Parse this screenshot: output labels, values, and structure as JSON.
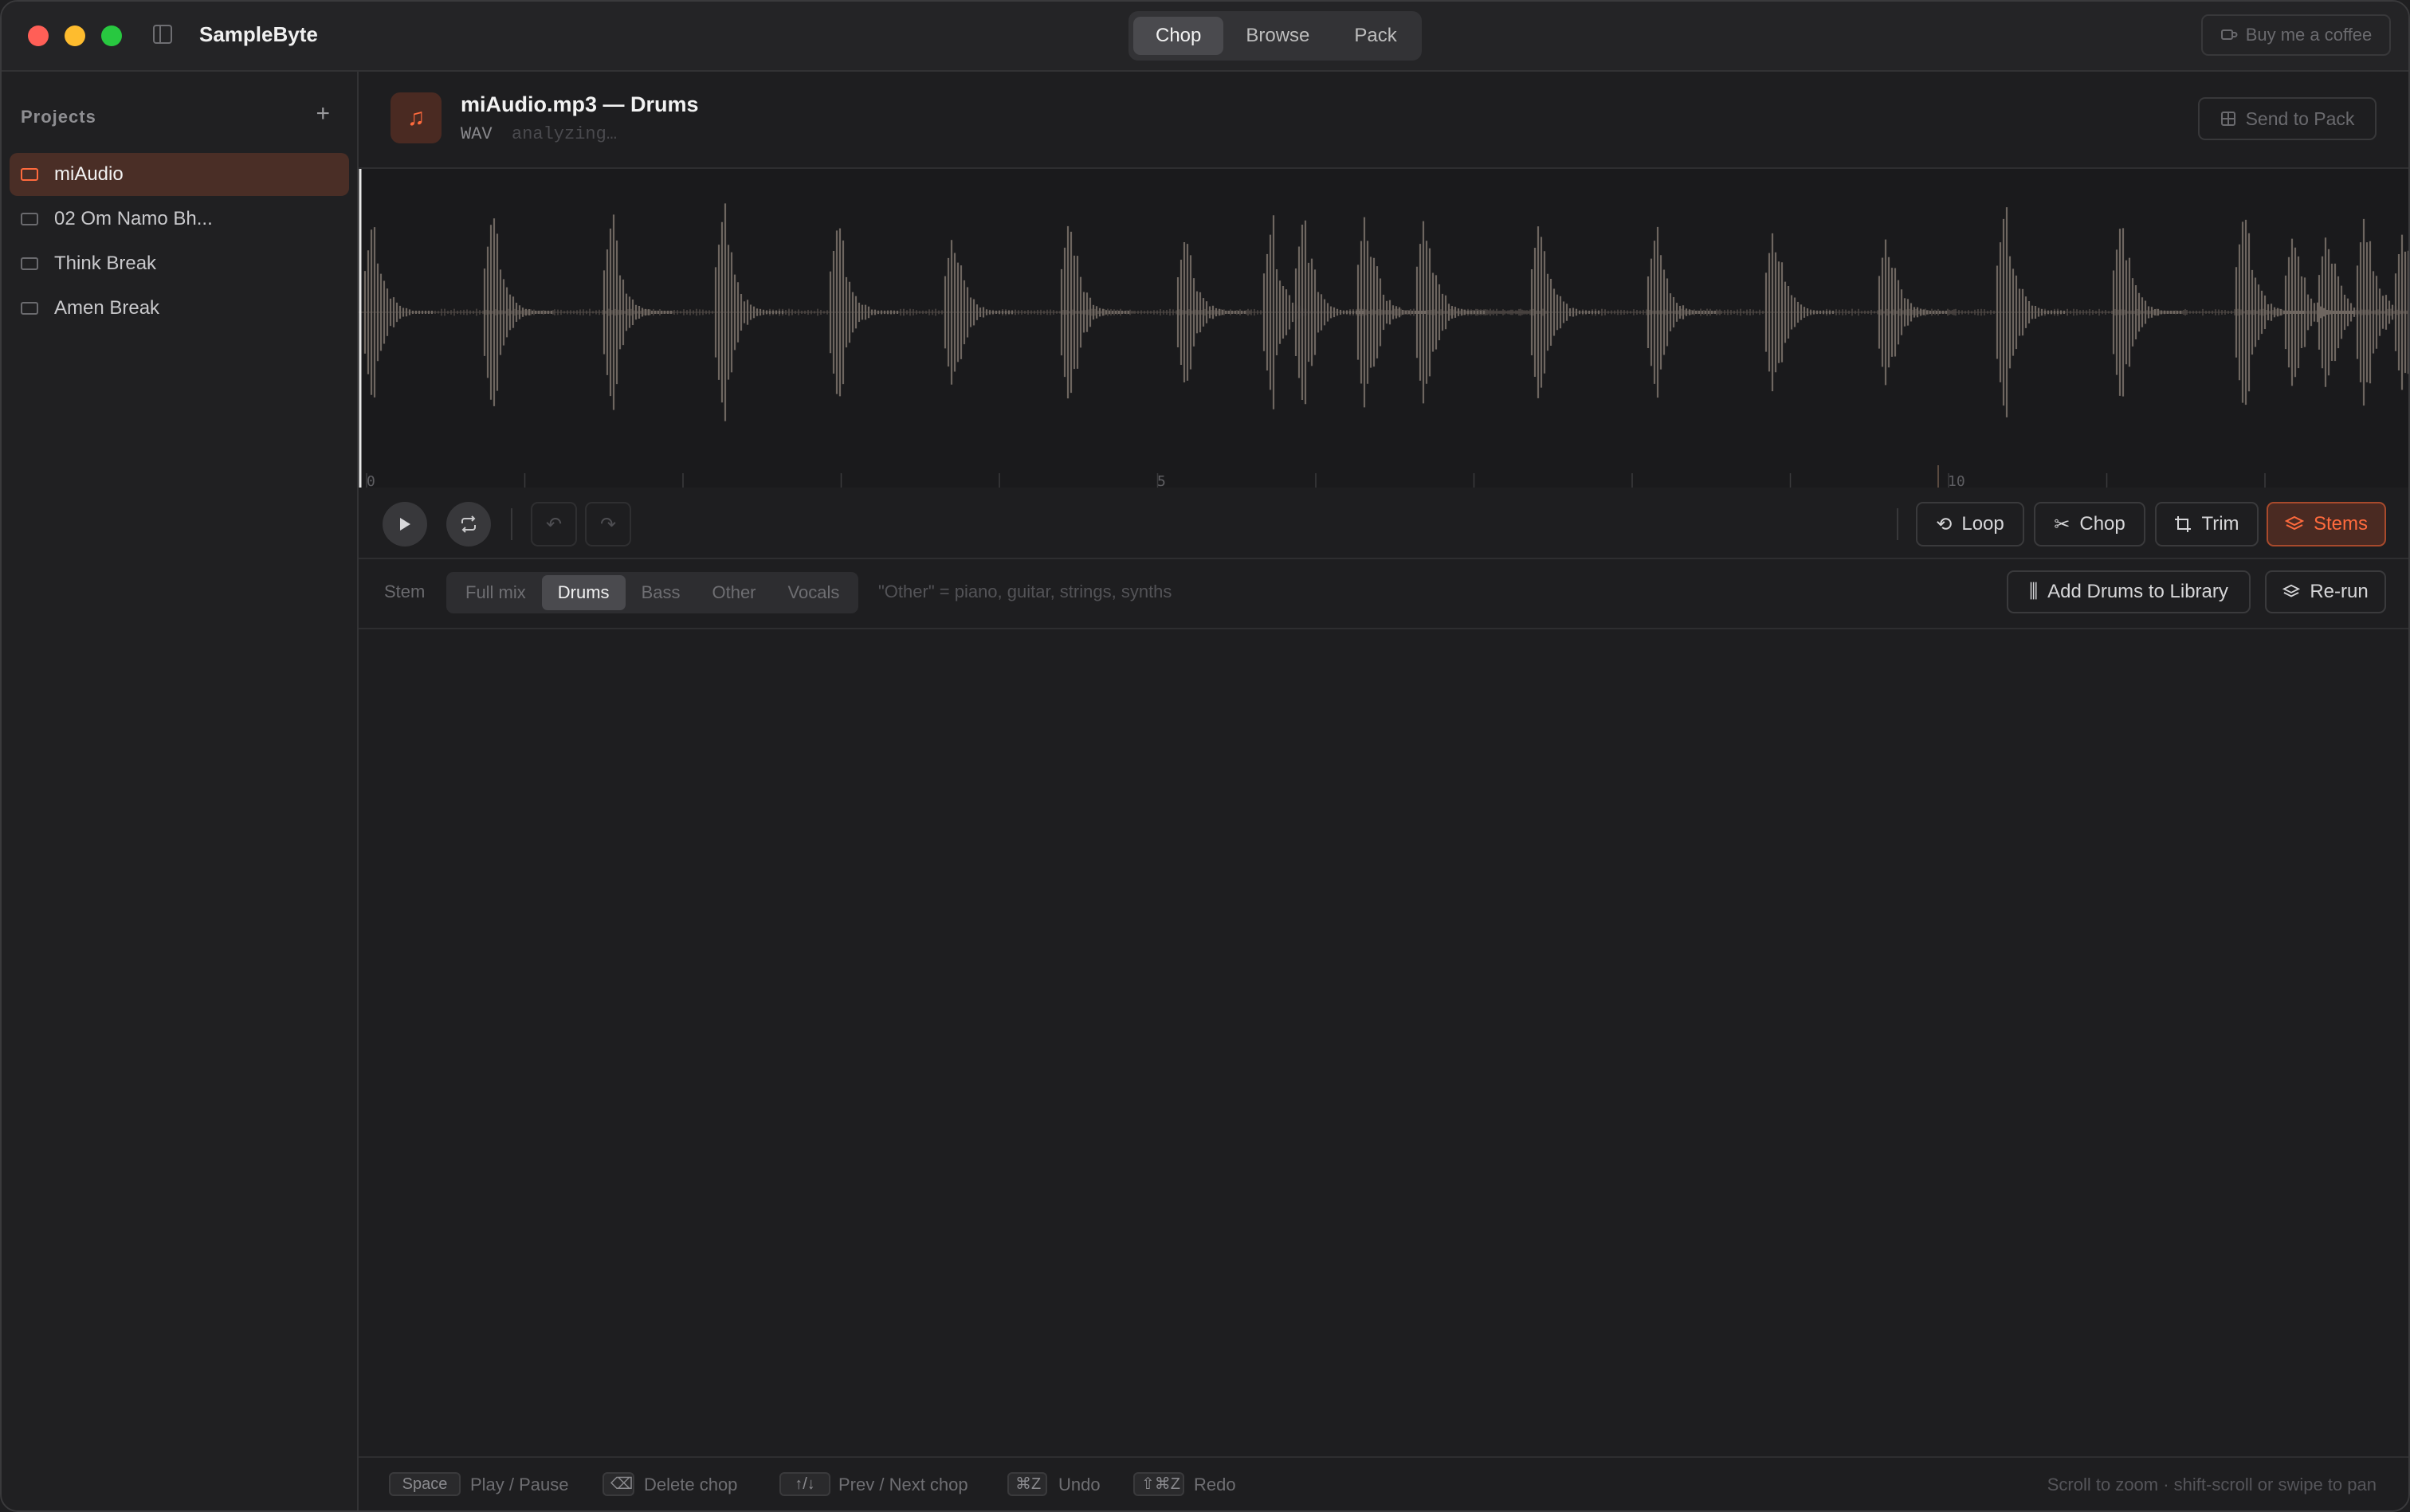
{
  "app": {
    "title": "SampleByte",
    "tabs": [
      "Chop",
      "Browse",
      "Pack"
    ],
    "active_tab": "Chop",
    "coffee_label": "Buy me a coffee"
  },
  "sidebar": {
    "heading": "Projects",
    "add_label": "+",
    "items": [
      {
        "label": "miAudio",
        "active": true
      },
      {
        "label": "02 Om Namo Bh...",
        "active": false
      },
      {
        "label": "Think Break",
        "active": false
      },
      {
        "label": "Amen Break",
        "active": false
      }
    ]
  },
  "file": {
    "title": "miAudio.mp3 — Drums",
    "format": "WAV",
    "status": "analyzing…",
    "send_label": "Send to Pack"
  },
  "timeline": {
    "ticks": [
      "0",
      "5",
      "10"
    ]
  },
  "toolbar": {
    "loop_label": "Loop",
    "chop_label": "Chop",
    "trim_label": "Trim",
    "stems_label": "Stems"
  },
  "stems": {
    "label": "Stem",
    "options": [
      "Full mix",
      "Drums",
      "Bass",
      "Other",
      "Vocals"
    ],
    "selected": "Drums",
    "hint": "\"Other\" = piano, guitar, strings, synths",
    "add_label": "Add Drums to Library",
    "rerun_label": "Re-run"
  },
  "shortcuts": [
    {
      "key": "Space",
      "label": "Play / Pause"
    },
    {
      "key": "⌫",
      "label": "Delete chop"
    },
    {
      "key": "↑/↓",
      "label": "Prev / Next chop"
    },
    {
      "key": "⌘Z",
      "label": "Undo"
    },
    {
      "key": "⇧⌘Z",
      "label": "Redo"
    }
  ],
  "footer_hint": "Scroll to zoom · shift-scroll or swipe to pan",
  "colors": {
    "accent": "#ff6a3d",
    "waveform": "#6e6660",
    "background": "#1e1e20"
  }
}
